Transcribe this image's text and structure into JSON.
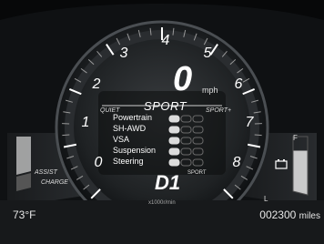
{
  "outside_temp": "73°F",
  "odometer": {
    "value": "002300",
    "unit": "miles"
  },
  "tachometer": {
    "ticks": [
      "1",
      "2",
      "3",
      "4",
      "5",
      "6",
      "7",
      "8",
      "0"
    ],
    "unit_label": "x1000r/min"
  },
  "speed": {
    "value": "0",
    "unit": "mph"
  },
  "drive_mode": {
    "title": "SPORT",
    "left_label": "QUIET",
    "right_label": "SPORT+"
  },
  "systems": [
    {
      "label": "Powertrain",
      "level": 1
    },
    {
      "label": "SH-AWD",
      "level": 1
    },
    {
      "label": "VSA",
      "level": 1
    },
    {
      "label": "Suspension",
      "level": 1
    },
    {
      "label": "Steering",
      "level": 1
    }
  ],
  "gear": {
    "value": "D1",
    "mode": "SPORT"
  },
  "hybrid_meter": {
    "assist_label": "ASSIST",
    "charge_label": "CHARGE"
  },
  "fuel_gauge": {
    "full_label": "F",
    "low_label": "L",
    "icon": "battery-icon",
    "level": 0.75
  },
  "colors": {
    "accent": "#ffffff",
    "background": "#0f1113",
    "bar_active": "#dcdcdc",
    "bar_inactive": "#6a6a6a"
  }
}
